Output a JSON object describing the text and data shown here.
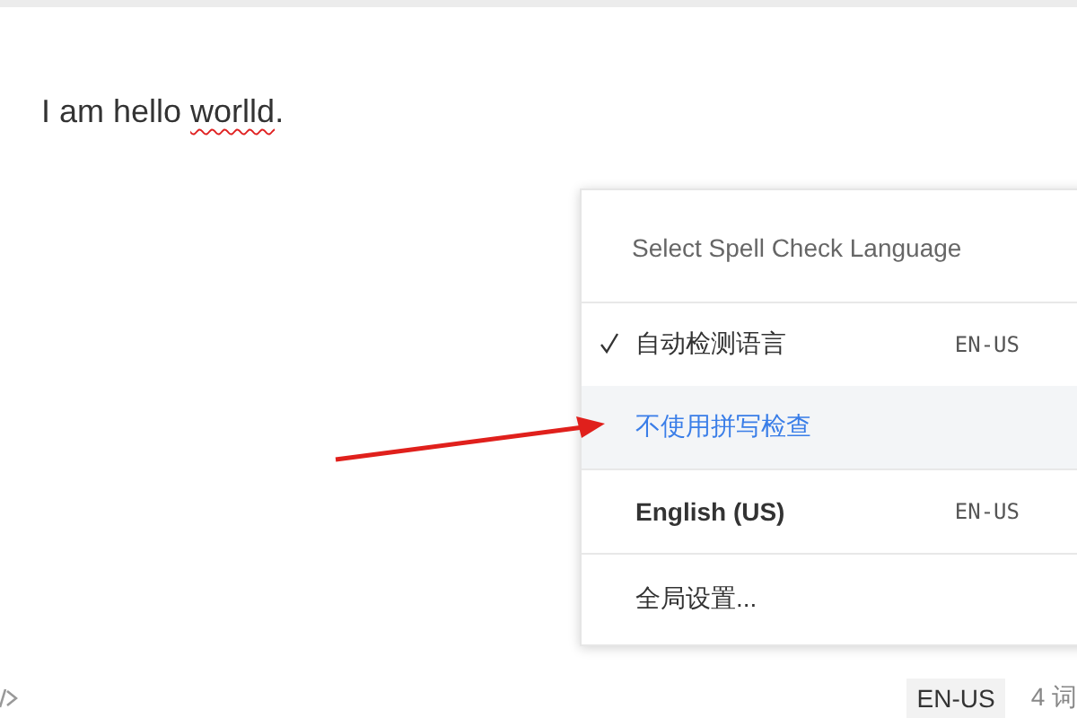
{
  "editor": {
    "segments": [
      {
        "text": "I am hello ",
        "misspelled": false
      },
      {
        "text": "worlld",
        "misspelled": true
      },
      {
        "text": ".",
        "misspelled": false
      }
    ]
  },
  "spell_menu": {
    "title": "Select Spell Check Language",
    "items": [
      {
        "kind": "option",
        "label": "自动检测语言",
        "code": "EN-US",
        "checked": true,
        "selected": false
      },
      {
        "kind": "option",
        "label": "不使用拼写检查",
        "checked": false,
        "selected": true
      },
      {
        "kind": "option",
        "label": "English (US)",
        "code": "EN-US",
        "checked": false,
        "selected": false
      },
      {
        "kind": "settings",
        "label": "全局设置..."
      }
    ]
  },
  "status_bar": {
    "language": "EN-US",
    "word_count": "4 词"
  }
}
